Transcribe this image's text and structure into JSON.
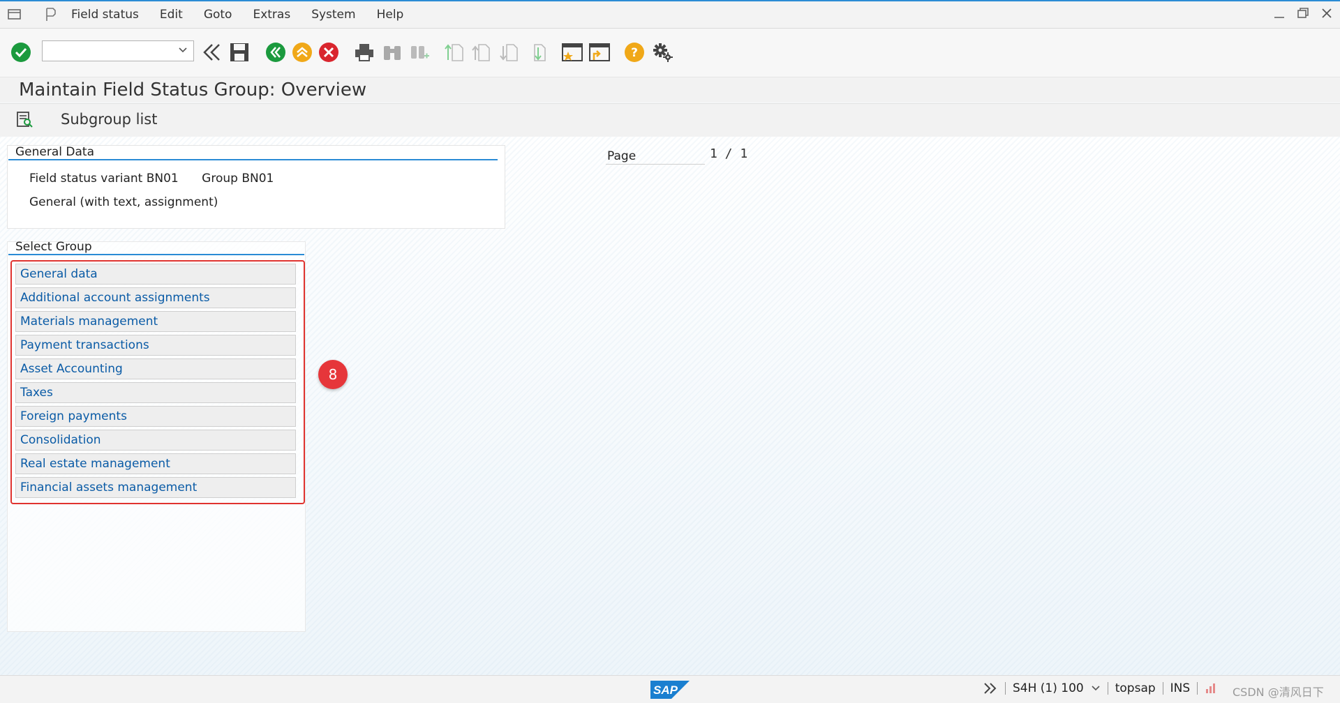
{
  "menubar": {
    "items": [
      "Field status",
      "Edit",
      "Goto",
      "Extras",
      "System",
      "Help"
    ]
  },
  "toolbar": {
    "command_value": "",
    "icons": [
      "enter-icon",
      "back-double-icon",
      "save-icon",
      "back-icon",
      "exit-icon",
      "cancel-icon",
      "print-icon",
      "find-icon",
      "find-next-icon",
      "first-page-icon",
      "prev-page-icon",
      "next-page-icon",
      "last-page-icon",
      "new-session-icon",
      "shortcut-icon",
      "help-icon",
      "settings-icon"
    ]
  },
  "title": "Maintain Field Status Group: Overview",
  "appbar": {
    "subgroup_label": "Subgroup list"
  },
  "general_data": {
    "heading": "General Data",
    "variant": "Field status variant BN01",
    "group": "Group BN01",
    "description": "General (with text, assignment)"
  },
  "page": {
    "label": "Page",
    "value": "1 / 1"
  },
  "select_group": {
    "heading": "Select Group",
    "items": [
      "General data",
      "Additional account assignments",
      "Materials management",
      "Payment transactions",
      "Asset Accounting",
      "Taxes",
      "Foreign payments",
      "Consolidation",
      "Real estate management",
      "Financial assets management"
    ]
  },
  "annotation": {
    "badge": "8",
    "highlight_color": "#e0332f"
  },
  "statusbar": {
    "logo": "SAP",
    "system": "S4H (1) 100",
    "user": "topsap",
    "mode": "INS",
    "watermark": "CSDN @清风日下"
  },
  "colors": {
    "accent": "#2a8bd5",
    "link": "#0a5ba6"
  }
}
